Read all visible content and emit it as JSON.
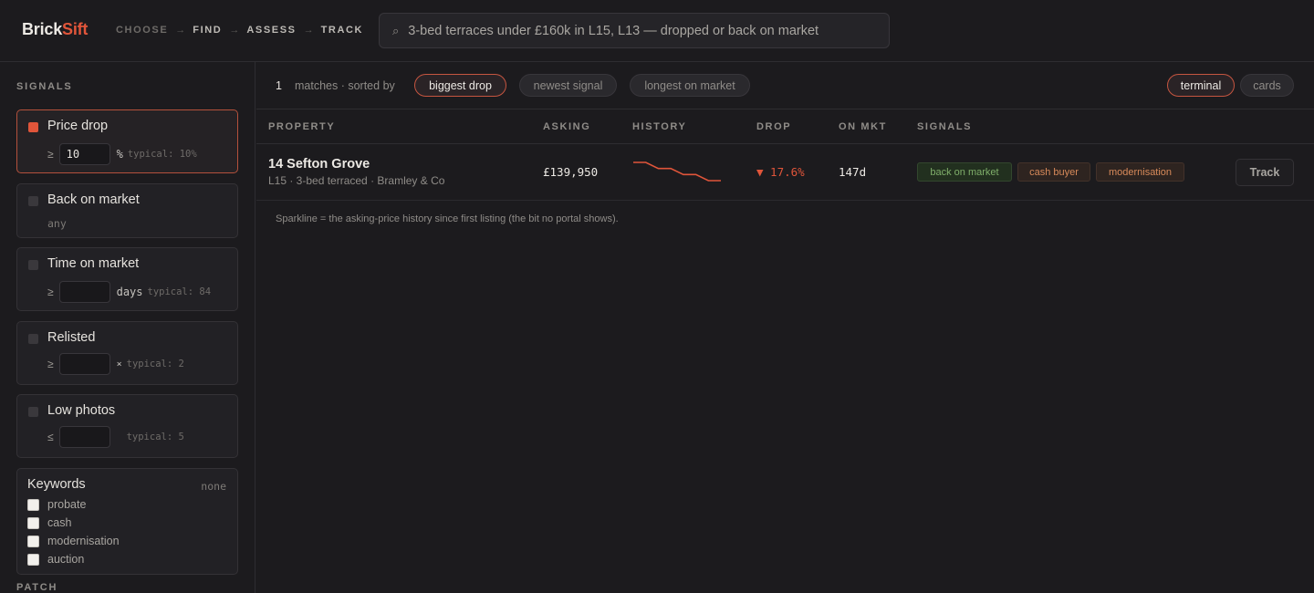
{
  "header": {
    "logo_a": "Brick",
    "logo_b": "Sift",
    "steps": [
      "CHOOSE",
      "FIND",
      "ASSESS",
      "TRACK"
    ],
    "search_value": "3-bed terraces under £160k in L15, L13 — dropped or back on market",
    "search_icon": "⌕"
  },
  "sidebar": {
    "signals_title": "SIGNALS",
    "price_drop": {
      "name": "Price drop",
      "op": "≥",
      "value": "10",
      "unit": "%",
      "hint": "typical: 10%"
    },
    "back_on_market": {
      "name": "Back on market",
      "value": "any"
    },
    "time_on_market": {
      "name": "Time on market",
      "op": "≥",
      "value": "",
      "unit": "days",
      "hint": "typical: 84"
    },
    "relisted": {
      "name": "Relisted",
      "op": "≥",
      "value": "",
      "unit": "×",
      "hint": "typical: 2"
    },
    "low_photos": {
      "name": "Low photos",
      "op": "≤",
      "value": "",
      "unit": "",
      "hint": "typical: 5"
    },
    "keywords": {
      "title": "Keywords",
      "status": "none",
      "options": [
        "probate",
        "cash",
        "modernisation",
        "auction"
      ]
    },
    "patch_title": "PATCH"
  },
  "toolbar": {
    "count": "1",
    "sort_label": "matches · sorted by",
    "sort_options": [
      "biggest drop",
      "newest signal",
      "longest on market"
    ],
    "view_options": [
      "terminal",
      "cards"
    ]
  },
  "table": {
    "headers": [
      "PROPERTY",
      "ASKING",
      "HISTORY",
      "DROP",
      "ON MKT",
      "SIGNALS"
    ],
    "rows": [
      {
        "address": "14 Sefton Grove",
        "meta": "L15 · 3-bed terraced · Bramley & Co",
        "asking": "£139,950",
        "drop": "▼ 17.6%",
        "on_market": "147d",
        "signals": [
          "back on market",
          "cash buyer",
          "modernisation"
        ],
        "track_label": "Track",
        "history": [
          170000,
          170000,
          160000,
          160000,
          150000,
          150000,
          139950,
          139950
        ]
      }
    ],
    "note": "Sparkline = the asking-price history since first listing (the bit no portal shows)."
  },
  "colors": {
    "accent": "#e0553a",
    "positive": "#7fae6a",
    "warning": "#d88a5a"
  }
}
